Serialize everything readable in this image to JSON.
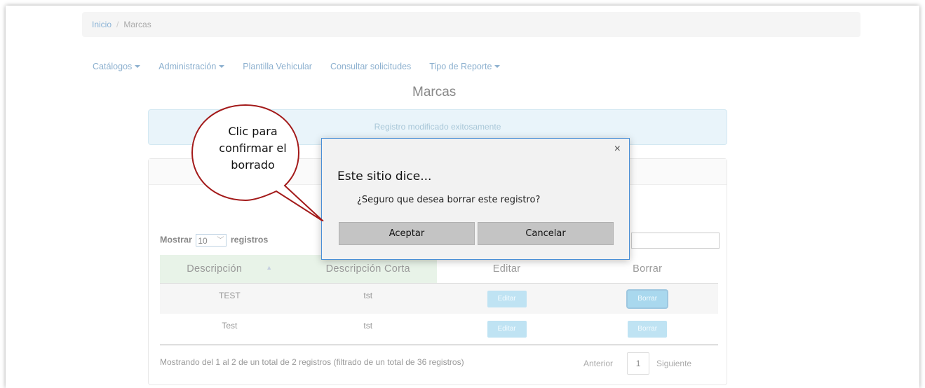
{
  "breadcrumb": {
    "home": "Inicio",
    "separator": "/",
    "current": "Marcas"
  },
  "nav": {
    "items": [
      {
        "label": "Catálogos",
        "dropdown": true
      },
      {
        "label": "Administración",
        "dropdown": true
      },
      {
        "label": "Plantilla Vehicular",
        "dropdown": false
      },
      {
        "label": "Consultar solicitudes",
        "dropdown": false
      },
      {
        "label": "Tipo de Reporte",
        "dropdown": true
      }
    ]
  },
  "page": {
    "title": "Marcas"
  },
  "alert": {
    "text": "Registro modificado exitosamente"
  },
  "table_controls": {
    "show_label": "Mostrar",
    "page_size": "10",
    "records_label": "registros"
  },
  "table": {
    "columns": [
      "Descripción",
      "Descripción Corta",
      "Editar",
      "Borrar"
    ],
    "rows": [
      {
        "descripcion": "TEST",
        "corta": "tst",
        "edit": "Editar",
        "delete": "Borrar"
      },
      {
        "descripcion": "Test",
        "corta": "tst",
        "edit": "Editar",
        "delete": "Borrar"
      }
    ]
  },
  "footer": {
    "info": "Mostrando del 1 al 2 de un total de 2 registros (filtrado de un total de 36 registros)",
    "prev": "Anterior",
    "page": "1",
    "next": "Siguiente"
  },
  "dialog": {
    "title": "Este sitio dice...",
    "message": "¿Seguro que desea borrar este registro?",
    "accept": "Aceptar",
    "cancel": "Cancelar",
    "close": "×"
  },
  "callout": {
    "line1": "Clic para",
    "line2": "confirmar el",
    "line3": "borrado"
  },
  "colors": {
    "link": "#8cb0cf",
    "callout_border": "#a31a1a",
    "dialog_border": "#4a8fd6",
    "button_light": "#bfe3f3"
  }
}
